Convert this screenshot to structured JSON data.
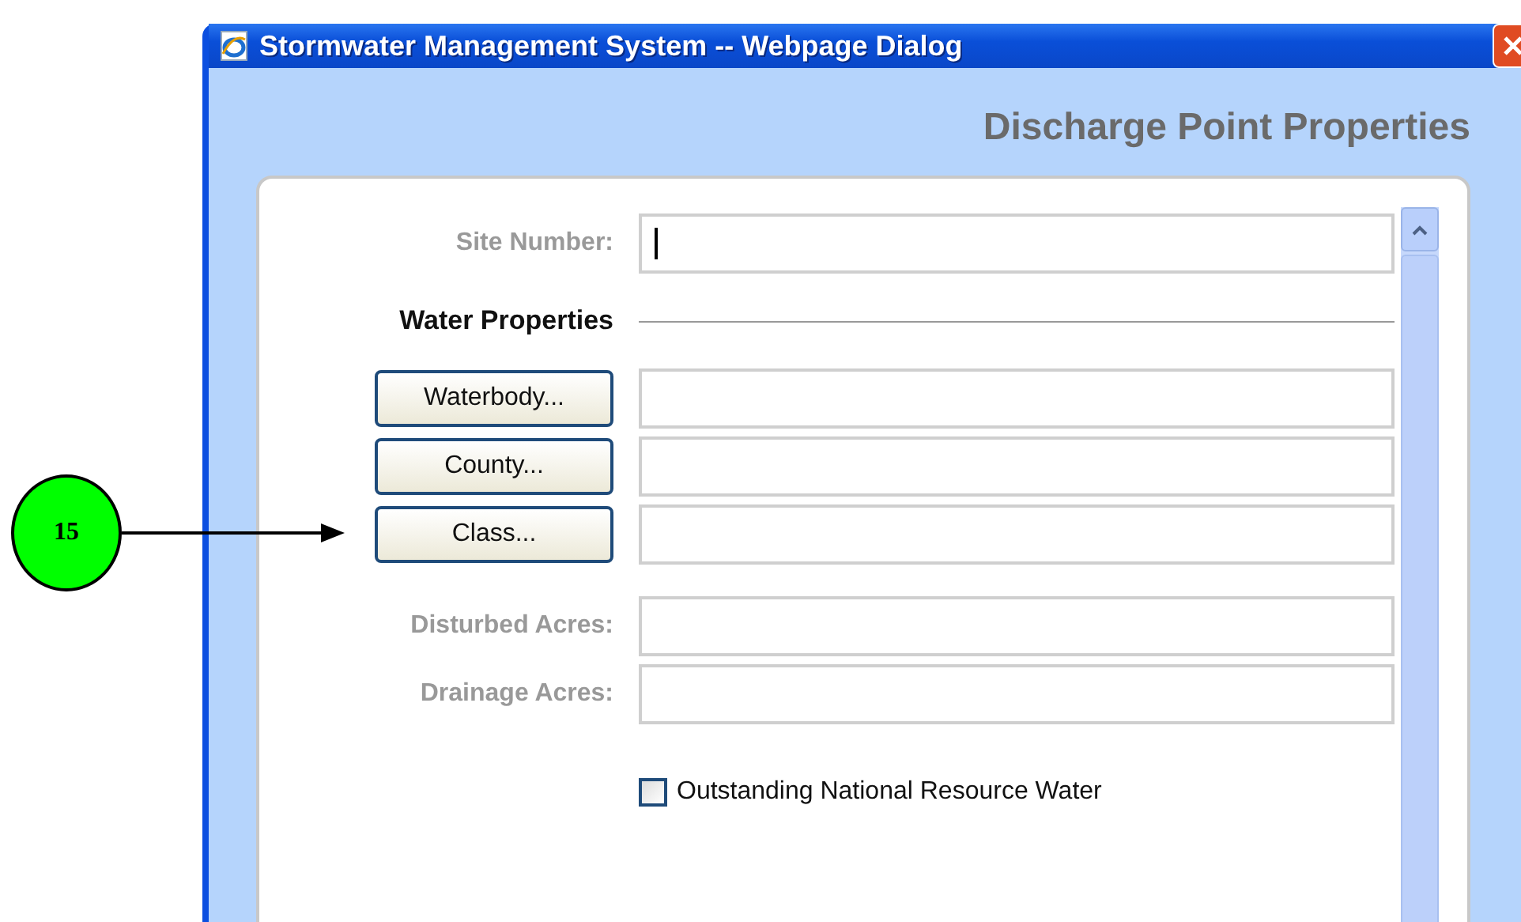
{
  "window": {
    "title": "Stormwater Management System -- Webpage Dialog"
  },
  "heading": "Discharge Point Properties",
  "site_number": {
    "label": "Site Number:"
  },
  "section": {
    "title": "Water Properties"
  },
  "lookups": [
    {
      "button": "Waterbody..."
    },
    {
      "button": "County..."
    },
    {
      "button": "Class..."
    }
  ],
  "acres_fields": [
    {
      "label": "Disturbed Acres:"
    },
    {
      "label": "Drainage Acres:"
    }
  ],
  "checkbox": {
    "label": "Outstanding National Resource Water",
    "checked": false
  },
  "callout": {
    "number": "15"
  }
}
